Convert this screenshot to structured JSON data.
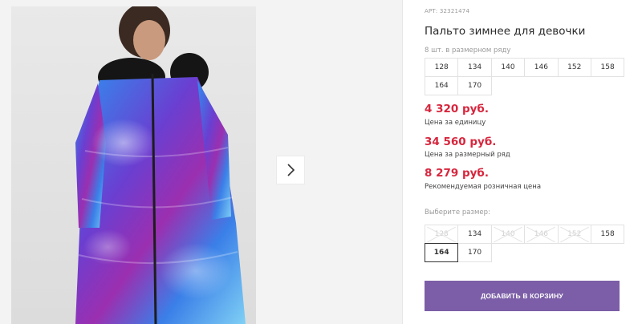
{
  "product": {
    "sku": "АРТ: 32321474",
    "title": "Пальто зимнее для девочки",
    "range_note": "8 шт. в размерном ряду",
    "range_sizes": [
      "128",
      "134",
      "140",
      "146",
      "152",
      "158",
      "164",
      "170"
    ]
  },
  "prices": {
    "unit_price": "4 320 руб.",
    "unit_label": "Цена за единицу",
    "range_price": "34 560 руб.",
    "range_label": "Цена за размерный ряд",
    "retail_price": "8 279 руб.",
    "retail_label": "Рекомендуемая розничная цена"
  },
  "size_select": {
    "label": "Выберите размер:",
    "options": [
      {
        "label": "128",
        "available": false
      },
      {
        "label": "134",
        "available": true
      },
      {
        "label": "140",
        "available": false
      },
      {
        "label": "146",
        "available": false
      },
      {
        "label": "152",
        "available": false
      },
      {
        "label": "158",
        "available": true
      },
      {
        "label": "164",
        "available": true,
        "selected": true
      },
      {
        "label": "170",
        "available": true
      }
    ]
  },
  "cart": {
    "add_label": "ДОБАВИТЬ В КОРЗИНУ"
  },
  "gallery": {
    "next_icon": "chevron-right-icon"
  },
  "colors": {
    "price": "#d7263d",
    "button": "#7b5ea7"
  }
}
